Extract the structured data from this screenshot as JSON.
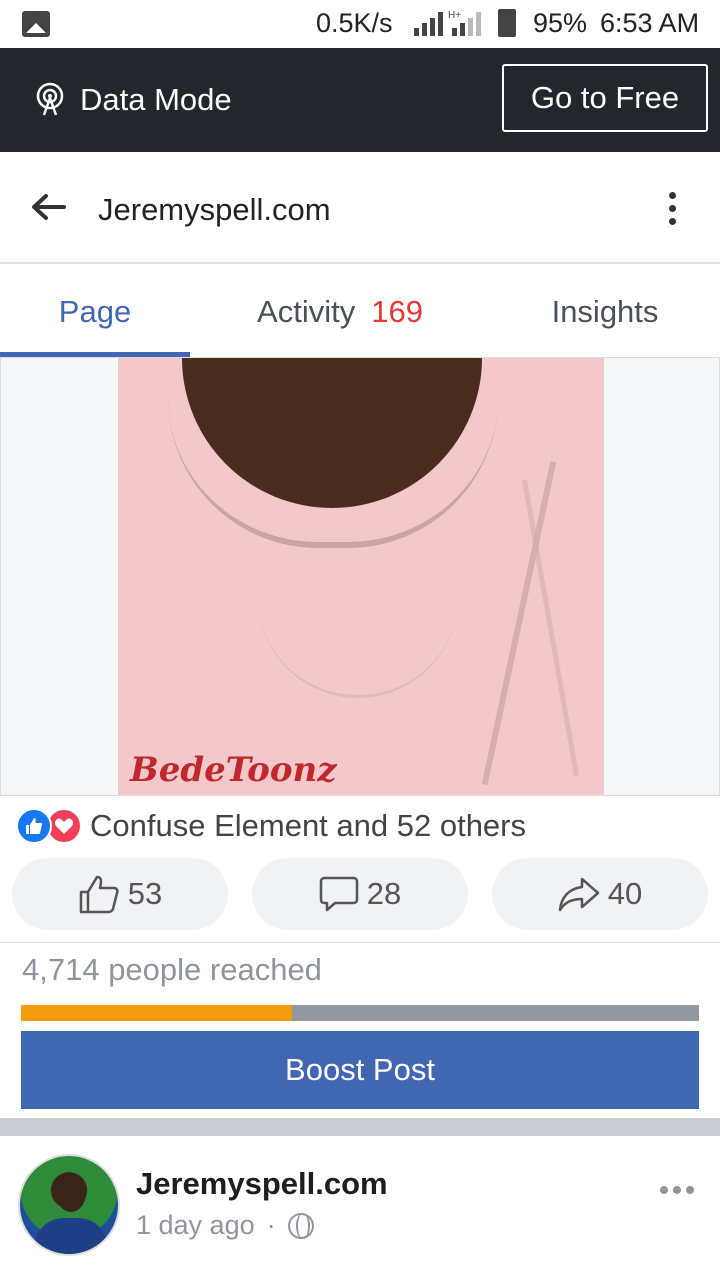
{
  "status_bar": {
    "speed": "0.5K/s",
    "network": "H+",
    "battery": "95%",
    "time": "6:53 AM"
  },
  "data_mode": {
    "label": "Data Mode",
    "free_button": "Go to Free"
  },
  "header": {
    "title": "Jeremyspell.com"
  },
  "tabs": [
    {
      "label": "Page",
      "active": true
    },
    {
      "label": "Activity",
      "count": "169",
      "active": false
    },
    {
      "label": "Insights",
      "active": false
    }
  ],
  "media": {
    "watermark": "BedeToonz"
  },
  "reactions": {
    "summary": "Confuse Element and 52 others"
  },
  "actions": {
    "likes": "53",
    "comments": "28",
    "shares": "40"
  },
  "reach": {
    "text": "4,714 people reached",
    "progress": 0.4
  },
  "boost": {
    "label": "Boost Post"
  },
  "next_post": {
    "author": "Jeremyspell.com",
    "time": "1 day ago",
    "separator": "·"
  },
  "colors": {
    "accent": "#4267b2",
    "tab_count": "#e53935",
    "progress_fill": "#f59c0b",
    "data_bar": "#23262c"
  }
}
